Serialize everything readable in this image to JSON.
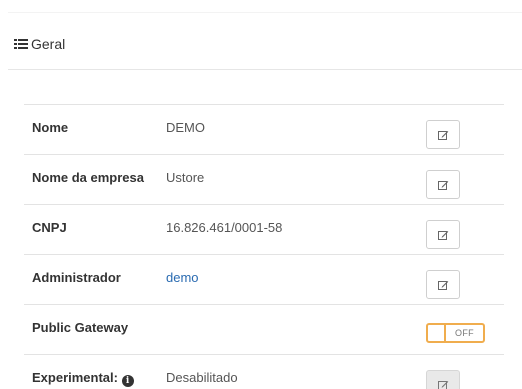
{
  "panel": {
    "title": "Geral"
  },
  "rows": [
    {
      "label": "Nome",
      "value": "DEMO"
    },
    {
      "label": "Nome da empresa",
      "value": "Ustore"
    },
    {
      "label": "CNPJ",
      "value": "16.826.461/0001-58"
    },
    {
      "label": "Administrador",
      "value": "demo"
    },
    {
      "label": "Public Gateway",
      "value": "",
      "toggle": "OFF"
    },
    {
      "label": "Experimental:",
      "value": "Desabilitado",
      "info_glyph": "i"
    }
  ],
  "icons": {
    "header": "list-icon",
    "edit": "edit-icon",
    "info": "info-circle-icon"
  },
  "colors": {
    "toggle_border": "#f0ad4e",
    "link": "#2a6bb1"
  }
}
